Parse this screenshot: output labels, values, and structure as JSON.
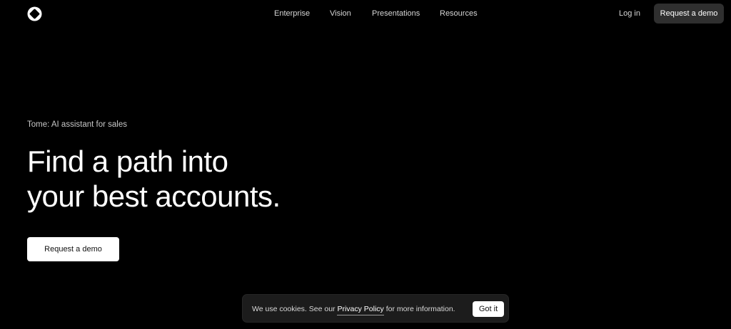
{
  "header": {
    "logo_icon": "tome-logo-icon",
    "nav": [
      {
        "label": "Enterprise"
      },
      {
        "label": "Vision"
      },
      {
        "label": "Presentations"
      },
      {
        "label": "Resources"
      }
    ],
    "login_label": "Log in",
    "demo_label": "Request a demo"
  },
  "hero": {
    "eyebrow": "Tome: AI assistant for sales",
    "title_line1": "Find a path into",
    "title_line2": "your best accounts.",
    "cta_label": "Request a demo"
  },
  "cookie_banner": {
    "text_before": "We use cookies. See our ",
    "link_label": "Privacy Policy",
    "text_after": " for more information.",
    "button_label": "Got it"
  },
  "colors": {
    "background": "#000000",
    "header_button": "#2f2f2f",
    "cta_button": "#ffffff",
    "banner": "#1c1c1c"
  }
}
